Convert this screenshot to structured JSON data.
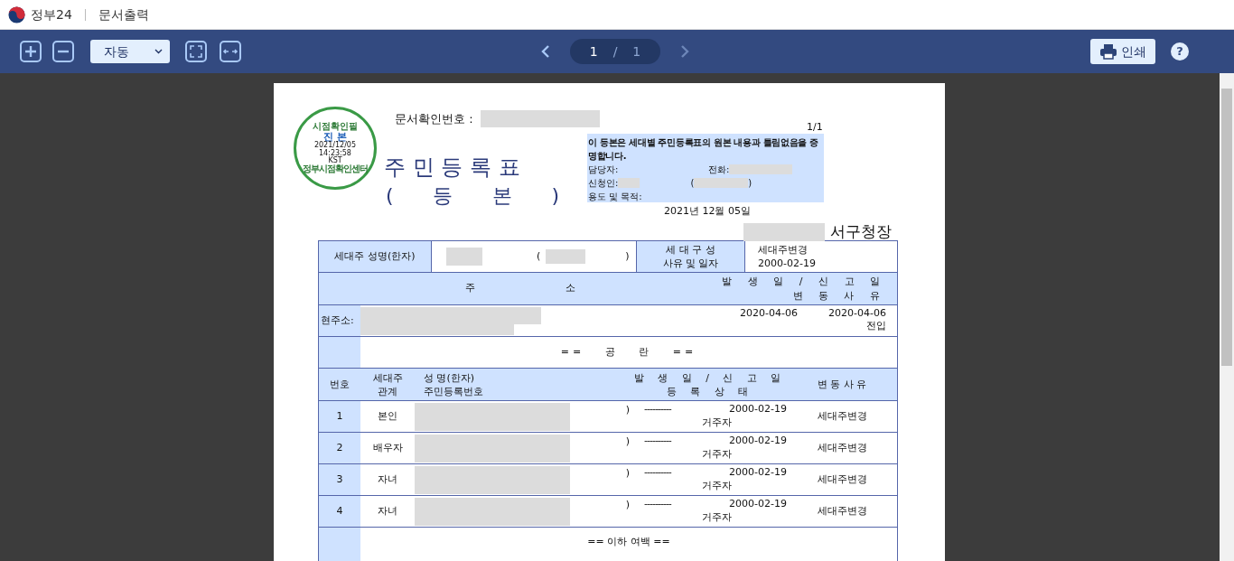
{
  "app": {
    "brand": "정부24",
    "title": "문서출력"
  },
  "toolbar": {
    "zoom_select": "자동",
    "page_current": "1",
    "page_separator": "/",
    "page_total": "1",
    "print_label": "인쇄",
    "help": "?"
  },
  "document": {
    "doc_number_label": "문서확인번호 :",
    "page_count": "1/1",
    "stamp": {
      "top": "시점확인필",
      "main": "진 본",
      "date": "2021/12/05",
      "time": "14:23:58",
      "zone": "KST",
      "bottom": "정부시점확인센터"
    },
    "title": "주 민 등 록 표",
    "subtitle": [
      "(",
      "등",
      "본",
      ")"
    ],
    "notice": "이 등본은 세대별 주민등록표의 원본 내용과 틀림없음을 증명합니다.",
    "contact_label": "담당자:",
    "phone_label": "전화:",
    "applicant_label": "신청인:",
    "paren_open": "(",
    "paren_close": ")",
    "purpose_label": "용도 및 목적:",
    "issue_date": "2021년 12월 05일",
    "issuer": "서구청장",
    "head_label": "세대주 성명(한자)",
    "head_paren_open": "(",
    "head_paren_close": ")",
    "composition_label": [
      "세 대 구 성",
      "사유 및 일자"
    ],
    "composition_value": [
      "세대주변경",
      "2000-02-19"
    ],
    "address_header": [
      "주",
      "소"
    ],
    "address_date_header": [
      "발 생 일 / 신 고 일",
      "변 동 사 유"
    ],
    "address_label": "현주소:",
    "address_dates": [
      "2020-04-06",
      "2020-04-06"
    ],
    "address_reason": "전입",
    "blank_note": "== 공 란 ==",
    "member_header": {
      "number": "번호",
      "relation": [
        "세대주",
        "관계"
      ],
      "name": [
        "성 명(한자)",
        "주민등록번호"
      ],
      "date": [
        "발 생 일 / 신 고 일",
        "등 록 상 태"
      ],
      "reason": "변 동 사 유"
    },
    "members": [
      {
        "number": "1",
        "relation": "본인",
        "paren": ")",
        "dashes": "----------",
        "date": "2000-02-19",
        "status": "거주자",
        "reason": "세대주변경"
      },
      {
        "number": "2",
        "relation": "배우자",
        "paren": ")",
        "dashes": "----------",
        "date": "2000-02-19",
        "status": "거주자",
        "reason": "세대주변경"
      },
      {
        "number": "3",
        "relation": "자녀",
        "paren": ")",
        "dashes": "----------",
        "date": "2000-02-19",
        "status": "거주자",
        "reason": "세대주변경"
      },
      {
        "number": "4",
        "relation": "자녀",
        "paren": ")",
        "dashes": "----------",
        "date": "2000-02-19",
        "status": "거주자",
        "reason": "세대주변경"
      }
    ],
    "end_note": "== 이하 여백 =="
  }
}
